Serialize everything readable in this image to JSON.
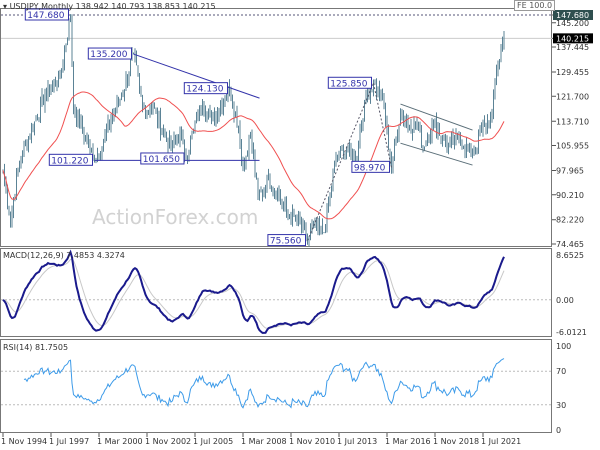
{
  "header": {
    "symbol": "USDJPY,Monthly",
    "ohlc": "138.942 140.793 138.853 140.215"
  },
  "fe_label": "FE 100.0",
  "watermark": "ActionForex.com",
  "colors": {
    "bars": "#5b8396",
    "ma": "#f05050",
    "macd": "#1a1a8c",
    "signal": "#c8c8c8",
    "rsi": "#3d9be9",
    "annot": "#3333aa",
    "channel": "#5a6e78"
  },
  "chart_data": [
    {
      "type": "ohlc",
      "title": "USDJPY,Monthly",
      "ylim": [
        74.465,
        147.68
      ],
      "y_ticks": [
        "147.680",
        "145.200",
        "140.215",
        "137.445",
        "129.455",
        "121.700",
        "113.710",
        "105.955",
        "97.965",
        "90.210",
        "82.220",
        "74.465"
      ],
      "x_ticks": [
        "1 Nov 1994",
        "1 Jul 1997",
        "1 Mar 2000",
        "1 Nov 2002",
        "1 Jul 2005",
        "1 Mar 2008",
        "1 Nov 2010",
        "1 Jul 2013",
        "1 Mar 2016",
        "1 Nov 2018",
        "1 Jul 2021"
      ],
      "last_price": "140.215",
      "close_keypoints": [
        [
          "1994-11",
          98
        ],
        [
          "1995-04",
          82
        ],
        [
          "1995-10",
          101
        ],
        [
          "1997-03",
          122
        ],
        [
          "1998-01",
          128
        ],
        [
          "1998-08",
          147.68
        ],
        [
          "1998-10",
          118
        ],
        [
          "1999-09",
          105
        ],
        [
          "1999-12",
          102
        ],
        [
          "2000-06",
          107
        ],
        [
          "2001-01",
          117
        ],
        [
          "2001-06",
          122
        ],
        [
          "2002-02",
          135.2
        ],
        [
          "2002-08",
          118
        ],
        [
          "2003-03",
          118
        ],
        [
          "2003-09",
          111
        ],
        [
          "2004-03",
          105
        ],
        [
          "2004-09",
          110
        ],
        [
          "2005-01",
          101.65
        ],
        [
          "2005-06",
          111
        ],
        [
          "2005-12",
          120
        ],
        [
          "2006-06",
          114
        ],
        [
          "2007-06",
          124.13
        ],
        [
          "2007-12",
          112
        ],
        [
          "2008-03",
          98
        ],
        [
          "2008-08",
          110
        ],
        [
          "2009-01",
          89
        ],
        [
          "2009-08",
          95
        ],
        [
          "2010-03",
          90
        ],
        [
          "2010-09",
          84
        ],
        [
          "2011-03",
          82
        ],
        [
          "2011-10",
          75.56
        ],
        [
          "2012-02",
          80
        ],
        [
          "2012-09",
          78
        ],
        [
          "2013-05",
          102
        ],
        [
          "2013-12",
          105
        ],
        [
          "2014-06",
          101
        ],
        [
          "2014-12",
          120
        ],
        [
          "2015-06",
          125.85
        ],
        [
          "2015-12",
          121
        ],
        [
          "2016-06",
          98.97
        ],
        [
          "2016-12",
          117
        ],
        [
          "2017-06",
          112
        ],
        [
          "2017-12",
          113
        ],
        [
          "2018-03",
          105
        ],
        [
          "2018-10",
          113
        ],
        [
          "2019-08",
          106
        ],
        [
          "2020-03",
          108
        ],
        [
          "2020-12",
          103
        ],
        [
          "2021-06",
          111
        ],
        [
          "2022-01",
          115
        ],
        [
          "2022-04",
          130
        ],
        [
          "2022-09",
          140.215
        ]
      ],
      "annotations": [
        {
          "label": "147.680",
          "date": "1998-08",
          "price": 147.68
        },
        {
          "label": "135.200",
          "date": "2002-02",
          "price": 135.2
        },
        {
          "label": "124.130",
          "date": "2007-06",
          "price": 124.13
        },
        {
          "label": "101.220",
          "date": "1999-12",
          "price": 101.22
        },
        {
          "label": "101.650",
          "date": "2005-01",
          "price": 101.65
        },
        {
          "label": "125.850",
          "date": "2015-06",
          "price": 125.85
        },
        {
          "label": "98.970",
          "date": "2016-06",
          "price": 98.97
        },
        {
          "label": "75.560",
          "date": "2011-10",
          "price": 75.56
        }
      ],
      "trendlines": [
        {
          "kind": "solid",
          "from": [
            "2002-02",
            135.2
          ],
          "to": [
            "2009-02",
            121.1
          ]
        },
        {
          "kind": "solid",
          "from": [
            "1999-12",
            101.22
          ],
          "to": [
            "2009-02",
            101.22
          ]
        },
        {
          "kind": "dotted",
          "from": [
            "2011-10",
            75.56
          ],
          "to": [
            "2015-06",
            125.85
          ]
        },
        {
          "kind": "dotted",
          "from": [
            "2015-06",
            125.85
          ],
          "to": [
            "2016-06",
            98.97
          ]
        },
        {
          "kind": "channel",
          "from": [
            "2016-12",
            119.2
          ],
          "to": [
            "2020-12",
            110.9
          ]
        },
        {
          "kind": "channel",
          "from": [
            "2016-12",
            106.7
          ],
          "to": [
            "2020-12",
            99.7
          ]
        }
      ]
    },
    {
      "type": "line",
      "title": "MACD(12,26,9) 7.4853 4.3274",
      "ylim": [
        -6.0121,
        8.6525
      ],
      "y_ticks": [
        "8.6525",
        "0.00",
        "-6.0121"
      ],
      "series": [
        {
          "name": "MACD"
        },
        {
          "name": "Signal"
        }
      ]
    },
    {
      "type": "line",
      "title": "RSI(14) 81.7505",
      "ylim": [
        0,
        100
      ],
      "y_ticks": [
        "100",
        "70",
        "30",
        "0"
      ],
      "series": [
        {
          "name": "RSI(14)"
        }
      ]
    }
  ]
}
